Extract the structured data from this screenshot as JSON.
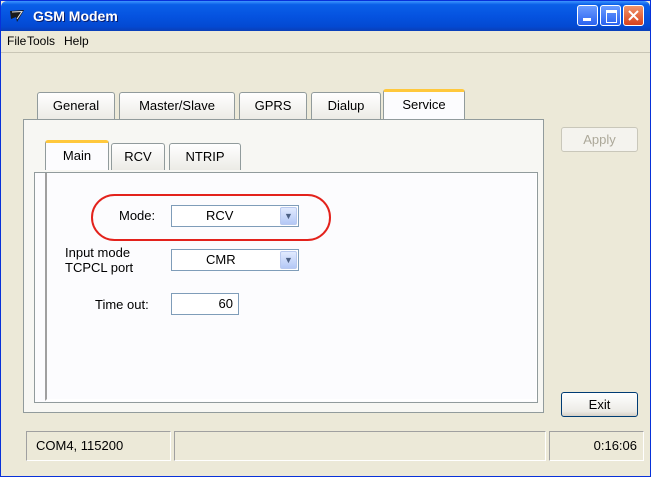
{
  "window": {
    "title": "GSM Modem"
  },
  "menu": {
    "items": [
      {
        "label": "File"
      },
      {
        "label": "Tools"
      },
      {
        "label": "Help"
      }
    ]
  },
  "tabs": [
    {
      "label": "General"
    },
    {
      "label": "Master/Slave"
    },
    {
      "label": "GPRS"
    },
    {
      "label": "Dialup"
    },
    {
      "label": "Service",
      "active": true
    }
  ],
  "subtabs": [
    {
      "label": "Main",
      "active": true
    },
    {
      "label": "RCV"
    },
    {
      "label": "NTRIP"
    }
  ],
  "form": {
    "mode_label": "Mode:",
    "mode_value": "RCV",
    "input_mode_label_line1": "Input mode",
    "input_mode_label_line2": "TCPCL port",
    "input_mode_value": "CMR",
    "timeout_label": "Time out:",
    "timeout_value": "60"
  },
  "buttons": {
    "apply": "Apply",
    "exit": "Exit"
  },
  "status": {
    "port": "COM4, 115200",
    "middle": "",
    "time": "0:16:06"
  },
  "colors": {
    "titlebar": "#0553e0",
    "highlight_ring": "#e3221c",
    "active_tab_accent": "#ffc83c"
  }
}
